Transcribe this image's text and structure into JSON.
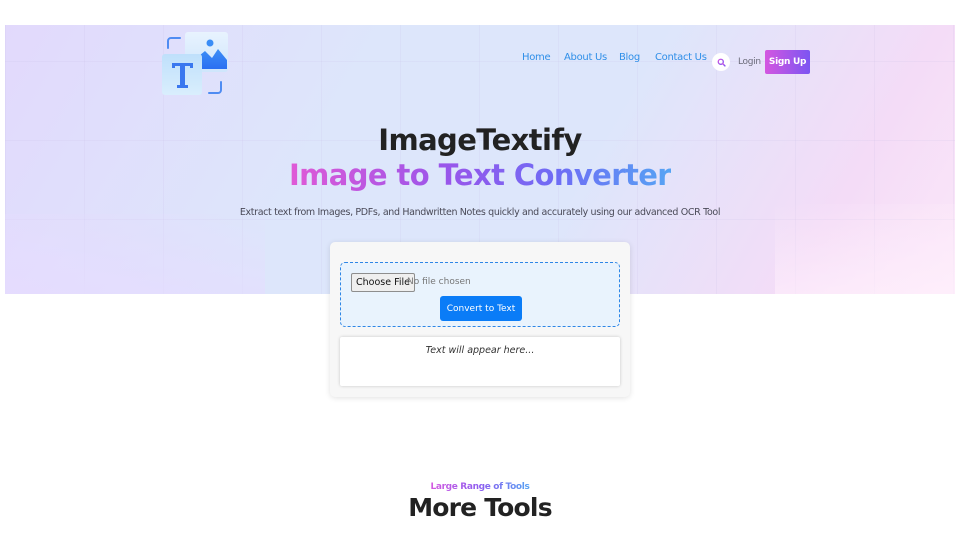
{
  "brand": {
    "name": "ImageTextify",
    "logo_icon": "text-image-logo-icon",
    "colors": {
      "primary_blue": "#0a7cf7",
      "nav_link": "#2f8fe8",
      "gradient_pink": "#e05ad6",
      "gradient_purple": "#9b55ea",
      "gradient_blue": "#56a4f4",
      "heading": "#222222"
    }
  },
  "nav": {
    "links": [
      {
        "label": "Home"
      },
      {
        "label": "About Us"
      },
      {
        "label": "Blog"
      },
      {
        "label": "Contact Us"
      }
    ],
    "search_icon": "search-icon",
    "login_label": "Login",
    "signup_label": "Sign Up"
  },
  "hero": {
    "title": "ImageTextify",
    "subtitle": "Image to Text Converter",
    "description": "Extract text from Images, PDFs, and Handwritten Notes quickly and accurately using our advanced OCR Tool"
  },
  "converter": {
    "choose_file_label": "Choose File",
    "file_status": "No file chosen",
    "convert_label": "Convert to Text",
    "output_placeholder": "Text will appear here..."
  },
  "tools_section": {
    "eyebrow": "Large Range of Tools",
    "title": "More Tools"
  }
}
